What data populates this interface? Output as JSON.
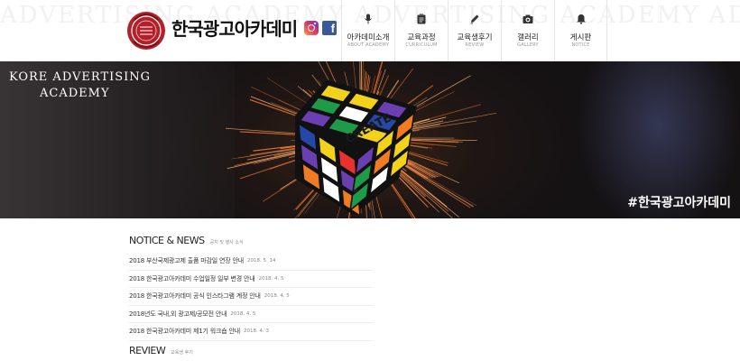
{
  "header": {
    "logo_text": "한국광고아카데미",
    "sns": [
      "instagram-icon",
      "facebook-icon"
    ],
    "facebook_glyph": "f",
    "nav": [
      {
        "label": "아카데미소개",
        "sub": "ABOUT ACADEMY",
        "icon": "microphone-icon"
      },
      {
        "label": "교육과정",
        "sub": "CURRICULUM",
        "icon": "clipboard-icon"
      },
      {
        "label": "교육생후기",
        "sub": "REVIEW",
        "icon": "pencil-icon"
      },
      {
        "label": "갤러리",
        "sub": "GALLERY",
        "icon": "camera-icon"
      },
      {
        "label": "게시판",
        "sub": "NOTICE",
        "icon": "bell-icon"
      }
    ]
  },
  "hero": {
    "brand_line1": "KORE ADVERTISING",
    "brand_line2": "ACADEMY",
    "cube_text": "CREATE",
    "hashtag": "#한국광고아카데미"
  },
  "notice": {
    "title": "NOTICE & NEWS",
    "subtitle": "공지 및 행사 소식",
    "items": [
      {
        "text": "2018 부산국제광고제 출품 마감일 연장 안내",
        "date": "2018. 5. 14"
      },
      {
        "text": "2018 한국광고아카데미 수업일정 일부 변경 안내",
        "date": "2018. 4. 5"
      },
      {
        "text": "2018 한국광고아카데미 공식 인스타그램 계정 안내",
        "date": "2018. 4. 5"
      },
      {
        "text": "2018년도 국내,외 광고제/공모전 안내",
        "date": "2018. 4. 5"
      },
      {
        "text": "2018 한국광고아카데미 제1기 워크숍 안내",
        "date": "2018. 4. 3"
      }
    ]
  },
  "review": {
    "title": "REVIEW",
    "subtitle": "교육생 후기"
  },
  "colors": {
    "instagram_gradient": [
      "#f9a03f",
      "#e4405f",
      "#b1308a",
      "#5b51d8"
    ],
    "facebook": "#3b5998",
    "hero_dark": "#1e1614",
    "spark": "#ff8a3a"
  }
}
